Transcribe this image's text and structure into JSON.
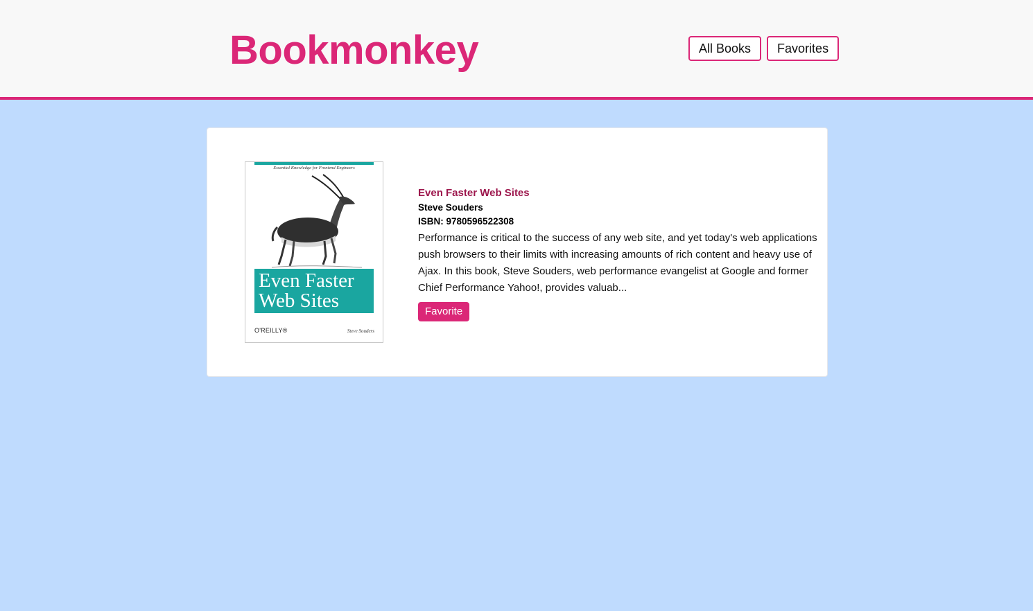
{
  "header": {
    "brand": "Bookmonkey",
    "nav": [
      {
        "label": "All Books"
      },
      {
        "label": "Favorites"
      }
    ]
  },
  "book": {
    "title": "Even Faster Web Sites",
    "author": "Steve Souders",
    "isbn": "ISBN: 9780596522308",
    "description": "Performance is critical to the success of any web site, and yet today's web applications push browsers to their limits with increasing amounts of rich content and heavy use of Ajax. In this book, Steve Souders, web performance evangelist at Google and former Chief Performance Yahoo!, provides valuab...",
    "favorite_label": "Favorite",
    "cover": {
      "tagline": "Essential Knowledge for Frontend Engineers",
      "title_line1": "Even Faster",
      "title_line2": "Web Sites",
      "publisher": "O'REILLY®",
      "author": "Steve Souders"
    }
  },
  "colors": {
    "accent": "#db2777",
    "title": "#9d174d",
    "background": "#bfdbfe",
    "cover_teal": "#1aa6a0"
  }
}
